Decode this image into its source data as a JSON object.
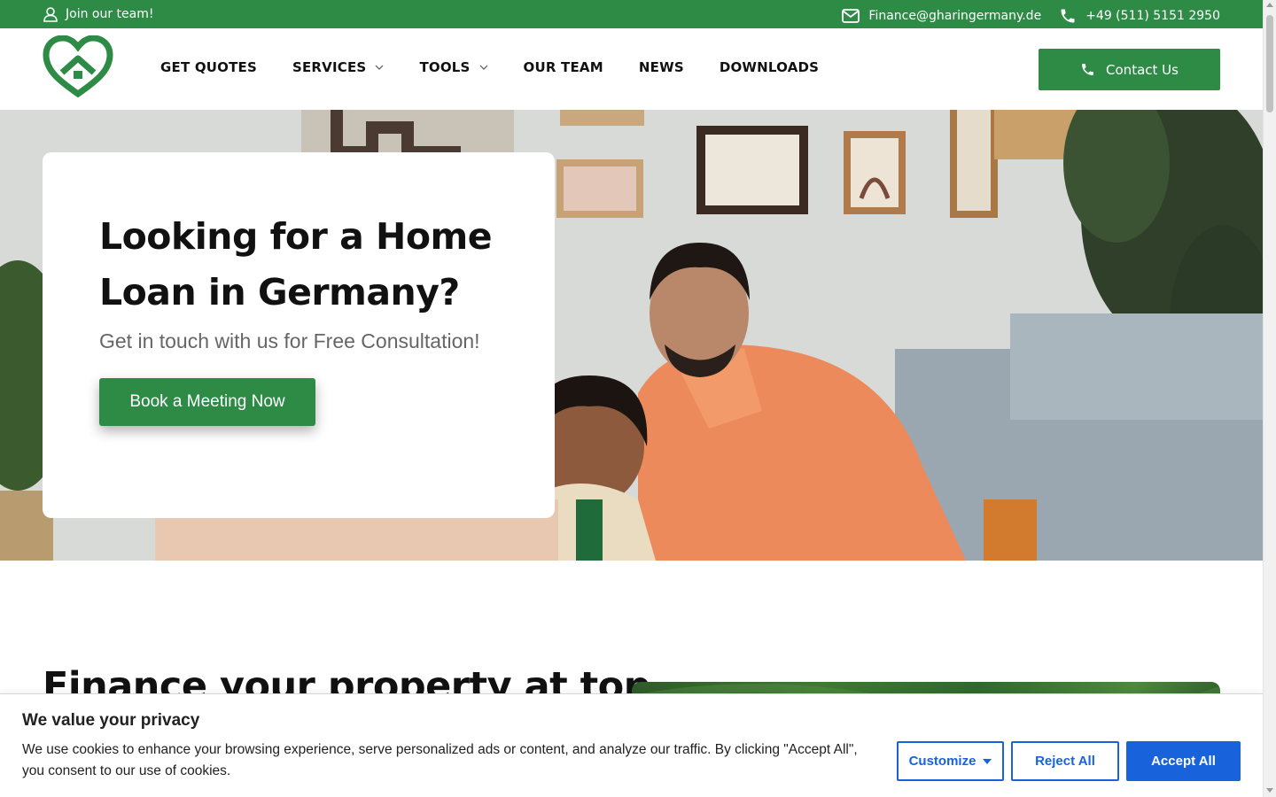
{
  "topbar": {
    "join_label": "Join our team!",
    "email": "Finance@gharingermany.de",
    "phone": "+49 (511) 5151 2950"
  },
  "nav": {
    "items": [
      {
        "label": "GET QUOTES",
        "has_dropdown": false
      },
      {
        "label": "SERVICES",
        "has_dropdown": true
      },
      {
        "label": "TOOLS",
        "has_dropdown": true
      },
      {
        "label": "OUR TEAM",
        "has_dropdown": false
      },
      {
        "label": "NEWS",
        "has_dropdown": false
      },
      {
        "label": "DOWNLOADS",
        "has_dropdown": false
      }
    ],
    "contact_label": "Contact Us"
  },
  "hero": {
    "title": "Looking for a Home Loan in Germany?",
    "subtitle": "Get in touch with us for Free Consultation!",
    "cta_label": "Book a Meeting Now"
  },
  "section": {
    "title": "Finance your property at top"
  },
  "cookie": {
    "title": "We value your privacy",
    "text": "We use cookies to enhance your browsing experience, serve personalized ads or content, and analyze our traffic. By clicking \"Accept All\", you consent to our use of cookies.",
    "customize_label": "Customize",
    "reject_label": "Reject All",
    "accept_label": "Accept All"
  },
  "colors": {
    "brand_green": "#2e8b46",
    "cookie_blue": "#1863dc"
  },
  "icons": [
    "user-icon",
    "envelope-icon",
    "phone-icon",
    "chevron-down-icon",
    "logo-heart-house"
  ]
}
